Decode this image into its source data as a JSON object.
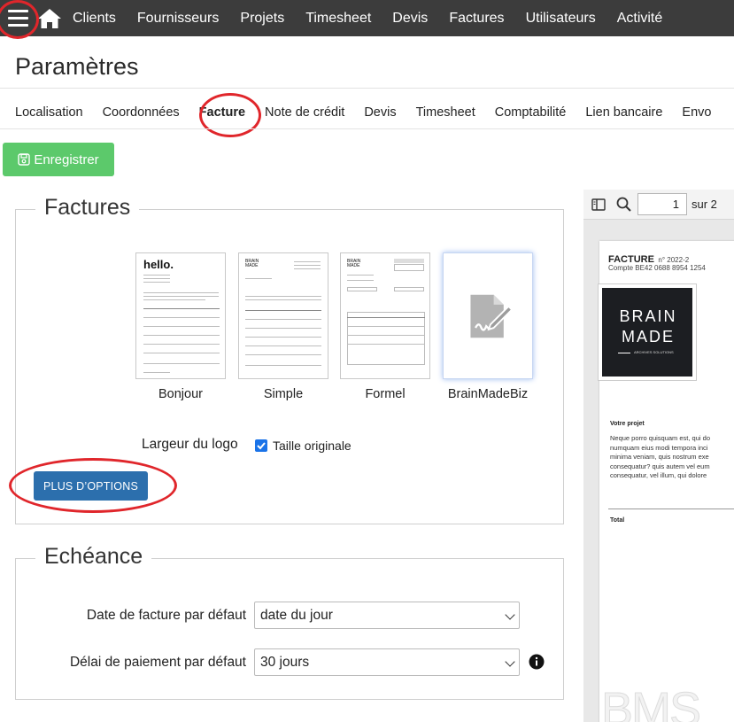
{
  "nav": {
    "items": [
      "Clients",
      "Fournisseurs",
      "Projets",
      "Timesheet",
      "Devis",
      "Factures",
      "Utilisateurs",
      "Activité"
    ]
  },
  "page_title": "Paramètres",
  "tabs": [
    "Localisation",
    "Coordonnées",
    "Facture",
    "Note de crédit",
    "Devis",
    "Timesheet",
    "Comptabilité",
    "Lien bancaire",
    "Envo"
  ],
  "active_tab": "Facture",
  "save_label": "Enregistrer",
  "factures": {
    "legend": "Factures",
    "templates": [
      {
        "label": "Bonjour",
        "thumb_title": "hello."
      },
      {
        "label": "Simple",
        "thumb_title": "BRAIN MADE"
      },
      {
        "label": "Formel",
        "thumb_title": "BRAIN MADE"
      },
      {
        "label": "BrainMadeBiz"
      }
    ],
    "logo_width_label": "Largeur du logo",
    "original_size_label": "Taille originale",
    "original_size_checked": true,
    "more_options_label": "PLUS D’OPTIONS"
  },
  "echeance": {
    "legend": "Echéance",
    "invoice_date_label": "Date de facture par défaut",
    "invoice_date_value": "date du jour",
    "payment_delay_label": "Délai de paiement par défaut",
    "payment_delay_value": "30 jours"
  },
  "pdf": {
    "page_input": "1",
    "page_total": "sur 2",
    "doc_title": "FACTURE",
    "doc_number": "n° 2022-2",
    "account_line": "Compte BE42 0688 8954 1254",
    "logo_line1": "BRAIN",
    "logo_line2": "MADE",
    "logo_tagline": "ARCHIVES SOLUTIONS",
    "project_heading": "Votre projet",
    "body_lines": [
      "Neque porro quisquam est, qui do",
      "numquam eius modi tempora inci",
      "minima veniam, quis nostrum exe",
      "consequatur? quis autem vel eum",
      "consequatur, vel illum, qui dolore"
    ],
    "total_label": "Total",
    "watermark": "BMS"
  },
  "colors": {
    "topbar": "#3c3c3c",
    "save_button": "#5cc96b",
    "primary_button": "#2c6fad",
    "annotation_red": "#e0262b",
    "checkbox": "#1a73e8"
  }
}
